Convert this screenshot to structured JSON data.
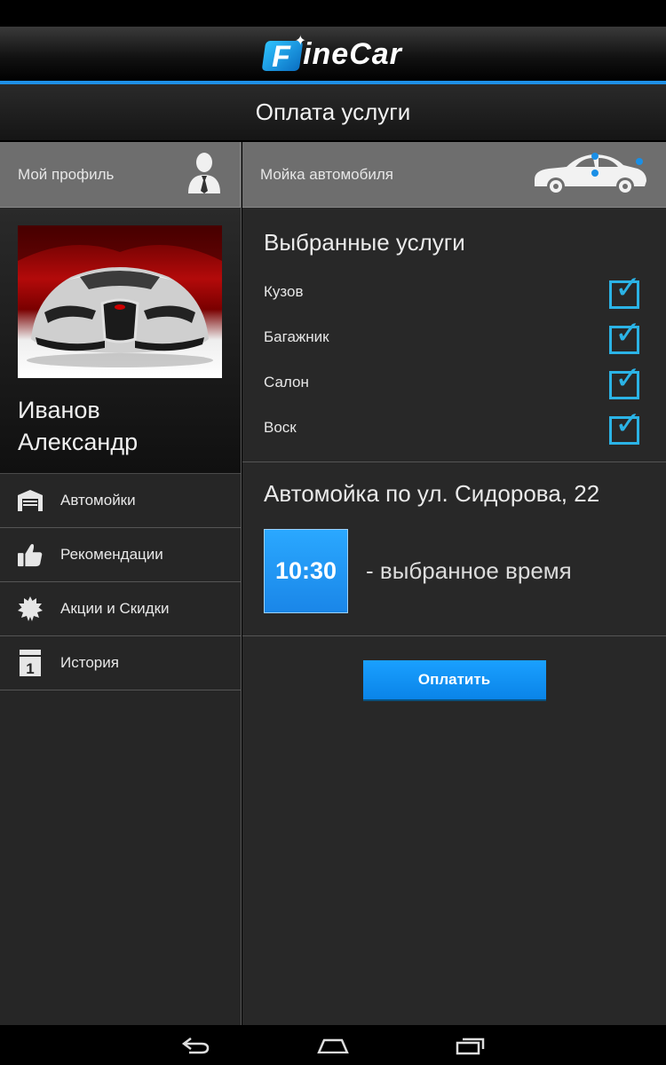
{
  "app": {
    "logo_text": "ineCar",
    "logo_letter": "F",
    "title": "Оплата услуги",
    "accent": "#1e90e6"
  },
  "left_tab": {
    "label": "Мой профиль",
    "icon": "user-silhouette-icon"
  },
  "right_tab": {
    "label": "Мойка автомобиля",
    "icon": "car-side-icon"
  },
  "profile": {
    "first_line": "Иванов",
    "second_line": "Александр",
    "photo": "sports-car-photo"
  },
  "menu": [
    {
      "label": "Автомойки",
      "icon": "garage-icon"
    },
    {
      "label": "Рекомендации",
      "icon": "thumbs-up-icon"
    },
    {
      "label": "Акции и Скидки",
      "icon": "starburst-icon"
    },
    {
      "label": "История",
      "icon": "calendar-icon"
    }
  ],
  "services": {
    "heading": "Выбранные услуги",
    "items": [
      {
        "label": "Кузов",
        "checked": true
      },
      {
        "label": "Багажник",
        "checked": true
      },
      {
        "label": "Салон",
        "checked": true
      },
      {
        "label": "Воск",
        "checked": true
      }
    ],
    "check_color": "#2bb3e6"
  },
  "carwash": {
    "address": "Автомойка по ул. Сидорова, 22",
    "time": "10:30",
    "time_note": "- выбранное время"
  },
  "pay_button": {
    "label": "Оплатить",
    "color": "#0a84e8"
  },
  "nav": {
    "back": "back-icon",
    "home": "home-icon",
    "recents": "recents-icon"
  }
}
